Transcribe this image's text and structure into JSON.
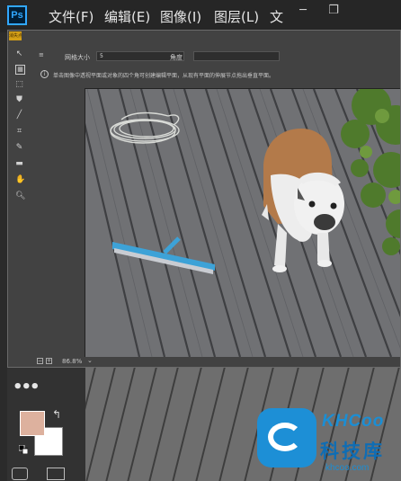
{
  "app": {
    "logo": "Ps",
    "menu": [
      "文件(F)",
      "编辑(E)",
      "图像(I)",
      "图层(L)",
      "文"
    ],
    "window_controls": {
      "minimize": "─",
      "restore": "❐"
    }
  },
  "dialog": {
    "title": "消失点",
    "options": {
      "menu_icon": "≡",
      "grid_size_label": "网格大小",
      "grid_size_value": "5",
      "angle_label": "角度"
    },
    "info_text": "单击图像中透视平面或对象的四个角可创建编辑平面，从现有平面的伸展节点拖出垂直平面。",
    "status": {
      "zoom_minus": "−",
      "zoom_plus": "+",
      "zoom_level": "86.8%",
      "zoom_caret": "⌄"
    }
  },
  "toolbox": {
    "more_tools": "•••",
    "foreground_color": "#ddb19e",
    "background_color": "#ffffff",
    "swap_icon": "↰"
  },
  "watermark": {
    "brand_en": "KHCoo",
    "brand_cn": "科技库",
    "url": "khcoo.com"
  }
}
